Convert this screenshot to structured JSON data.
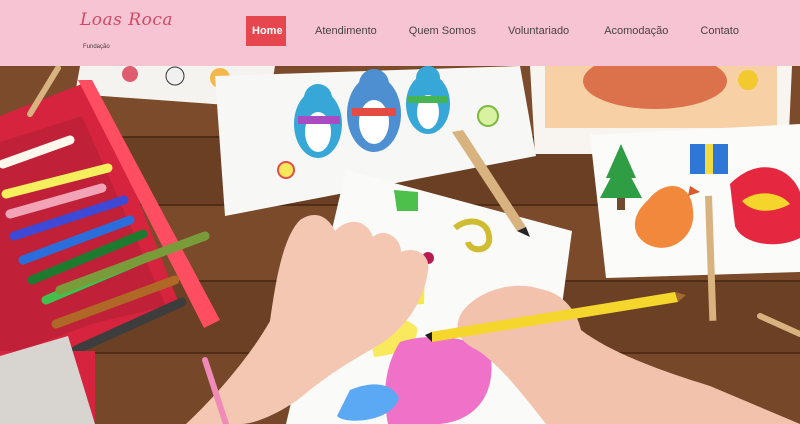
{
  "brand": {
    "logo_text": "Loas Roca",
    "sub_text": "Fundação"
  },
  "nav": {
    "items": [
      {
        "label": "Home",
        "active": true
      },
      {
        "label": "Atendimento",
        "active": false
      },
      {
        "label": "Quem Somos",
        "active": false
      },
      {
        "label": "Voluntariado",
        "active": false
      },
      {
        "label": "Acomodação",
        "active": false
      },
      {
        "label": "Contato",
        "active": false
      }
    ]
  },
  "colors": {
    "header_bg": "#f6c4d2",
    "active_nav_bg": "#e6474f",
    "nav_text": "#4a4343",
    "wood_table": "#6e4326"
  },
  "hero": {
    "image": "children-coloring-drawings-photo"
  }
}
